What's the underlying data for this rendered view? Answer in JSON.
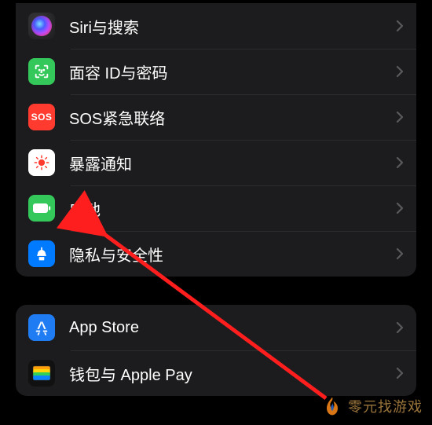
{
  "groups": [
    {
      "items": [
        {
          "key": "siri",
          "label": "Siri与搜索",
          "icon": "siri-icon"
        },
        {
          "key": "faceid",
          "label": "面容 ID与密码",
          "icon": "faceid-icon"
        },
        {
          "key": "sos",
          "label": "SOS紧急联络",
          "icon": "sos-icon",
          "sos_text": "SOS"
        },
        {
          "key": "exposure",
          "label": "暴露通知",
          "icon": "exposure-icon"
        },
        {
          "key": "battery",
          "label": "电池",
          "icon": "battery-icon"
        },
        {
          "key": "privacy",
          "label": "隐私与安全性",
          "icon": "privacy-icon"
        }
      ]
    },
    {
      "items": [
        {
          "key": "appstore",
          "label": "App Store",
          "icon": "appstore-icon"
        },
        {
          "key": "wallet",
          "label": "钱包与 Apple Pay",
          "icon": "wallet-icon"
        }
      ]
    }
  ],
  "watermark": {
    "text": "零元找游戏"
  },
  "arrow": {
    "points_to": "battery"
  }
}
